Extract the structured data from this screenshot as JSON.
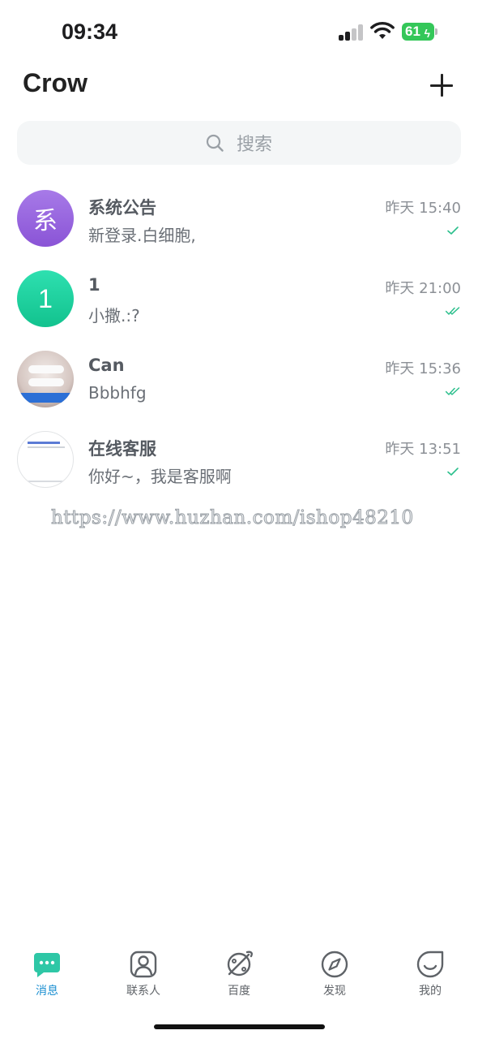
{
  "status_bar": {
    "time": "09:34",
    "battery": "61"
  },
  "header": {
    "title": "Crow",
    "add_icon": "plus-icon"
  },
  "search": {
    "placeholder": "搜索",
    "icon": "search-icon"
  },
  "conversations": [
    {
      "name": "系统公告",
      "preview": "新登录.白细胞,",
      "time": "昨天 15:40",
      "avatar_text": "系",
      "avatar_color": "#9b67e0",
      "read_status": "single-check"
    },
    {
      "name": "1",
      "preview": "小撒.:?",
      "time": "昨天 21:00",
      "avatar_text": "1",
      "avatar_color": "#1fd3a0",
      "read_status": "double-check"
    },
    {
      "name": "Can",
      "preview": "Bbbhfg",
      "time": "昨天 15:36",
      "avatar_text": "",
      "read_status": "double-check"
    },
    {
      "name": "在线客服",
      "preview": "你好~，我是客服啊",
      "time": "昨天 13:51",
      "avatar_text": "",
      "read_status": "single-check"
    }
  ],
  "watermark": "https://www.huzhan.com/ishop48210",
  "tab_bar": {
    "tabs": [
      {
        "label": "消息",
        "icon": "chat-bubble-icon",
        "active": true
      },
      {
        "label": "联系人",
        "icon": "contact-icon",
        "active": false
      },
      {
        "label": "百度",
        "icon": "planet-icon",
        "active": false
      },
      {
        "label": "发现",
        "icon": "compass-icon",
        "active": false
      },
      {
        "label": "我的",
        "icon": "profile-icon",
        "active": false
      }
    ]
  },
  "colors": {
    "accent": "#1c8fd1",
    "check": "#2bbf8c",
    "battery": "#34c759"
  }
}
